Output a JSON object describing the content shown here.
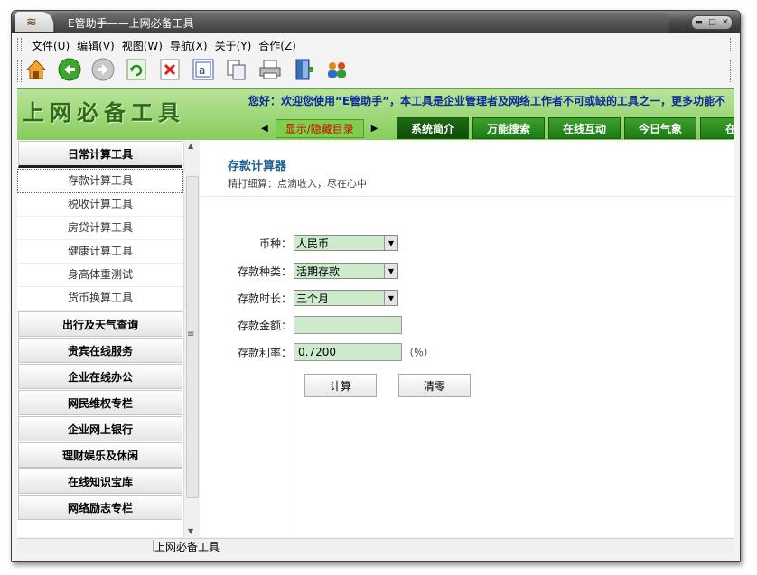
{
  "window": {
    "title": "E管助手——上网必备工具"
  },
  "menu": [
    {
      "label": "文件(U)"
    },
    {
      "label": "编辑(V)"
    },
    {
      "label": "视图(W)"
    },
    {
      "label": "导航(X)"
    },
    {
      "label": "关于(Y)"
    },
    {
      "label": "合作(Z)"
    }
  ],
  "toolbar_icons": [
    "home-icon",
    "back-icon",
    "forward-icon",
    "refresh-icon",
    "stop-icon",
    "find-icon",
    "copy-icon",
    "print-icon",
    "exit-icon",
    "users-icon"
  ],
  "banner": {
    "title": "上网必备工具",
    "marquee": "您好：欢迎您使用“E管助手”，本工具是企业管理者及网络工作者不可或缺的工具之一，更多功能不",
    "toggle": "显示/隐藏目录",
    "tabs": [
      "系统简介",
      "万能搜索",
      "在线互动",
      "今日气象",
      "在线"
    ]
  },
  "sidebar": {
    "open_group": "日常计算工具",
    "items": [
      "存款计算工具",
      "税收计算工具",
      "房贷计算工具",
      "健康计算工具",
      "身高体重测试",
      "货币换算工具"
    ],
    "groups": [
      "出行及天气查询",
      "贵宾在线服务",
      "企业在线办公",
      "网民维权专栏",
      "企业网上银行",
      "理财娱乐及休闲",
      "在线知识宝库",
      "网络励志专栏"
    ]
  },
  "content": {
    "heading": "存款计算器",
    "subtitle": "精打细算：点滴收入，尽在心中",
    "fields": {
      "currency_label": "币种：",
      "currency_value": "人民币",
      "type_label": "存款种类：",
      "type_value": "活期存款",
      "term_label": "存款时长：",
      "term_value": "三个月",
      "amount_label": "存款金额：",
      "amount_value": "",
      "rate_label": "存款利率：",
      "rate_value": "0.7200",
      "rate_unit": "（％）"
    },
    "calc_button": "计算",
    "clear_button": "清零"
  },
  "status": {
    "text": "上网必备工具"
  }
}
